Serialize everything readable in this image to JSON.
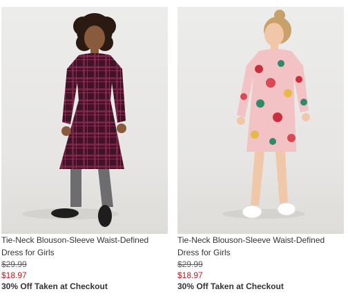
{
  "products": [
    {
      "image_alt": "Girl in purple plaid tie-neck blouson-sleeve dress with gray tights and black shoes",
      "title": "Tie-Neck Blouson-Sleeve Waist-Defined Dress for Girls",
      "price_was": "$29.99",
      "price_now": "$18.97",
      "promo": "30% Off Taken at Checkout",
      "dress_color": "#4a1a2e",
      "accent_color": "#c4161c"
    },
    {
      "image_alt": "Girl in pink floral tie-neck blouson-sleeve dress with white sneakers",
      "title": "Tie-Neck Blouson-Sleeve Waist-Defined Dress for Girls",
      "price_was": "$29.99",
      "price_now": "$18.97",
      "promo": "30% Off Taken at Checkout",
      "dress_color": "#f2c2c4",
      "accent_color": "#c4161c"
    }
  ]
}
